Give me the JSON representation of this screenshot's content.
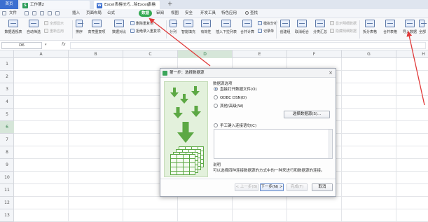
{
  "titlebar": {
    "home_tab": "首页",
    "tab1_label": "工作簿2",
    "tab1_icon": "S",
    "tab2_label": "Excel表格技巧...除Excel表格",
    "tab2_icon": "W",
    "add_tab": "+"
  },
  "menubar": {
    "file": "文件",
    "items": [
      "插入",
      "页面布局",
      "公式",
      "数据",
      "审阅",
      "视图",
      "安全",
      "开发工具",
      "特色应用"
    ],
    "active_item": "数据",
    "search_label": "查找"
  },
  "ribbon": {
    "pivot_table": "数据透视表",
    "auto_filter": "自动筛选",
    "show_all": "全部显示",
    "reapply": "重新应用",
    "sort": "排序",
    "highlight_dup": "高亮重复项",
    "data_compare": "数据对比",
    "remove_dup": "删除重复项",
    "reject_dup_entry": "拒绝录入重复项",
    "split": "分列",
    "smart_fill": "智能填充",
    "validity": "有效性",
    "insert_dropdown": "插入下拉列表",
    "merge_calc": "合并计算",
    "simulate": "模拟分析",
    "record_sheet": "记录单",
    "create_group": "创建组",
    "ungroup": "取消组合",
    "subtotal": "分类汇总",
    "show_detail": "显示明细数据",
    "hide_detail": "隐藏明细数据",
    "split_sheet": "拆分表格",
    "merge_sheet": "合并表格",
    "import_data": "导入数据",
    "all_ellipsis": "全部"
  },
  "formula_bar": {
    "name_box": "D6",
    "fx": "fx",
    "value": ""
  },
  "grid": {
    "columns": [
      "A",
      "B",
      "C",
      "D",
      "E",
      "F",
      "G",
      "H"
    ],
    "rows": [
      "1",
      "2",
      "3",
      "4",
      "5",
      "6",
      "7",
      "8",
      "9",
      "10",
      "11",
      "12",
      "13"
    ],
    "selected_column": "D",
    "selected_row": "6"
  },
  "dialog": {
    "title": "第一步：选择数据源",
    "close": "×",
    "group_title": "数据源选项",
    "opt_file": "直接打开数据文件(O)",
    "opt_odbc": "ODBC DSN(D)",
    "opt_other": "其他/高级(W)",
    "select_source_btn": "选择数据源(S)...",
    "opt_sql": "手工键入连接语句(C)",
    "note_title": "说明",
    "note_text": "可以选择四种连接数据源的方式中的一种来进行和数据源的连接。",
    "back_btn": "< 上一步(B)",
    "next_btn": "下一步(N) >",
    "finish_btn": "完成(F)",
    "cancel_btn": "取消"
  },
  "colors": {
    "accent_green": "#33a852",
    "annotation_red": "#e03a3a",
    "brand_blue": "#3c6fd0"
  }
}
